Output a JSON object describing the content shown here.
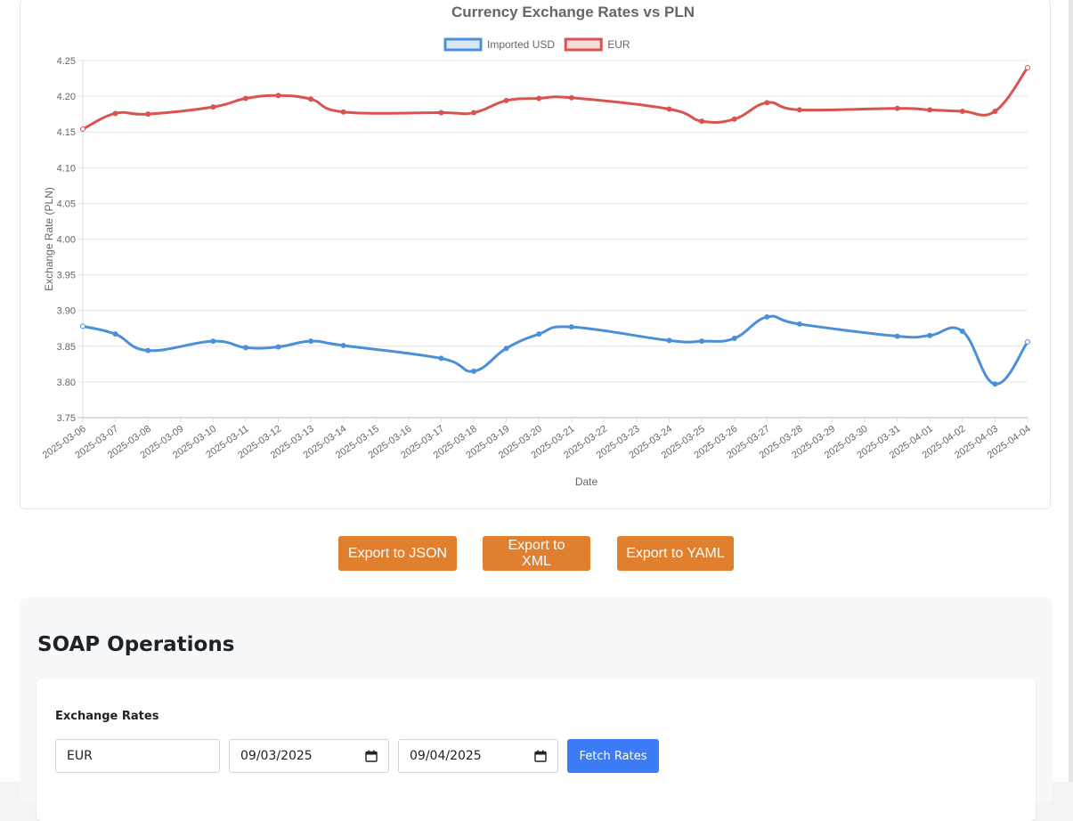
{
  "chart_data": {
    "type": "line",
    "title": "Currency Exchange Rates vs PLN",
    "xlabel": "Date",
    "ylabel": "Exchange Rate (PLN)",
    "ylim": [
      3.75,
      4.25
    ],
    "yticks": [
      "4.25",
      "4.20",
      "4.15",
      "4.10",
      "4.05",
      "4.00",
      "3.95",
      "3.90",
      "3.85",
      "3.80",
      "3.75"
    ],
    "grid": true,
    "legend_position": "top",
    "categories": [
      "2025-03-06",
      "2025-03-07",
      "2025-03-08",
      "2025-03-09",
      "2025-03-10",
      "2025-03-11",
      "2025-03-12",
      "2025-03-13",
      "2025-03-14",
      "2025-03-15",
      "2025-03-16",
      "2025-03-17",
      "2025-03-18",
      "2025-03-19",
      "2025-03-20",
      "2025-03-21",
      "2025-03-22",
      "2025-03-23",
      "2025-03-24",
      "2025-03-25",
      "2025-03-26",
      "2025-03-27",
      "2025-03-28",
      "2025-03-29",
      "2025-03-30",
      "2025-03-31",
      "2025-04-01",
      "2025-04-02",
      "2025-04-03",
      "2025-04-04"
    ],
    "series": [
      {
        "name": "Imported USD",
        "color": "#4a90d9",
        "points": [
          {
            "x": "2025-03-06",
            "y": 3.878
          },
          {
            "x": "2025-03-07",
            "y": 3.867
          },
          {
            "x": "2025-03-08",
            "y": 3.844
          },
          {
            "x": "2025-03-10",
            "y": 3.857
          },
          {
            "x": "2025-03-11",
            "y": 3.848
          },
          {
            "x": "2025-03-12",
            "y": 3.849
          },
          {
            "x": "2025-03-13",
            "y": 3.857
          },
          {
            "x": "2025-03-14",
            "y": 3.851
          },
          {
            "x": "2025-03-17",
            "y": 3.833
          },
          {
            "x": "2025-03-18",
            "y": 3.815
          },
          {
            "x": "2025-03-19",
            "y": 3.847
          },
          {
            "x": "2025-03-20",
            "y": 3.867
          },
          {
            "x": "2025-03-21",
            "y": 3.877
          },
          {
            "x": "2025-03-24",
            "y": 3.858
          },
          {
            "x": "2025-03-25",
            "y": 3.857
          },
          {
            "x": "2025-03-26",
            "y": 3.861
          },
          {
            "x": "2025-03-27",
            "y": 3.891
          },
          {
            "x": "2025-03-28",
            "y": 3.881
          },
          {
            "x": "2025-03-31",
            "y": 3.864
          },
          {
            "x": "2025-04-01",
            "y": 3.865
          },
          {
            "x": "2025-04-02",
            "y": 3.871
          },
          {
            "x": "2025-04-03",
            "y": 3.797
          },
          {
            "x": "2025-04-04",
            "y": 3.856
          }
        ]
      },
      {
        "name": "EUR",
        "color": "#d9534f",
        "points": [
          {
            "x": "2025-03-06",
            "y": 4.154
          },
          {
            "x": "2025-03-07",
            "y": 4.176
          },
          {
            "x": "2025-03-08",
            "y": 4.175
          },
          {
            "x": "2025-03-10",
            "y": 4.185
          },
          {
            "x": "2025-03-11",
            "y": 4.197
          },
          {
            "x": "2025-03-12",
            "y": 4.201
          },
          {
            "x": "2025-03-13",
            "y": 4.196
          },
          {
            "x": "2025-03-14",
            "y": 4.178
          },
          {
            "x": "2025-03-17",
            "y": 4.177
          },
          {
            "x": "2025-03-18",
            "y": 4.177
          },
          {
            "x": "2025-03-19",
            "y": 4.194
          },
          {
            "x": "2025-03-20",
            "y": 4.197
          },
          {
            "x": "2025-03-21",
            "y": 4.198
          },
          {
            "x": "2025-03-24",
            "y": 4.182
          },
          {
            "x": "2025-03-25",
            "y": 4.165
          },
          {
            "x": "2025-03-26",
            "y": 4.168
          },
          {
            "x": "2025-03-27",
            "y": 4.191
          },
          {
            "x": "2025-03-28",
            "y": 4.181
          },
          {
            "x": "2025-03-31",
            "y": 4.183
          },
          {
            "x": "2025-04-01",
            "y": 4.181
          },
          {
            "x": "2025-04-02",
            "y": 4.179
          },
          {
            "x": "2025-04-03",
            "y": 4.179
          },
          {
            "x": "2025-04-04",
            "y": 4.24
          }
        ]
      }
    ]
  },
  "export": {
    "json_label": "Export to JSON",
    "xml_label": "Export to XML",
    "yaml_label": "Export to YAML",
    "color": "#e07f2e"
  },
  "soap": {
    "title": "SOAP Operations",
    "exchange_rates": {
      "title": "Exchange Rates",
      "currency_value": "EUR",
      "start_date": "09/03/2025",
      "end_date": "09/04/2025",
      "fetch_label": "Fetch Rates",
      "fetch_color": "#3b7cf6"
    }
  }
}
